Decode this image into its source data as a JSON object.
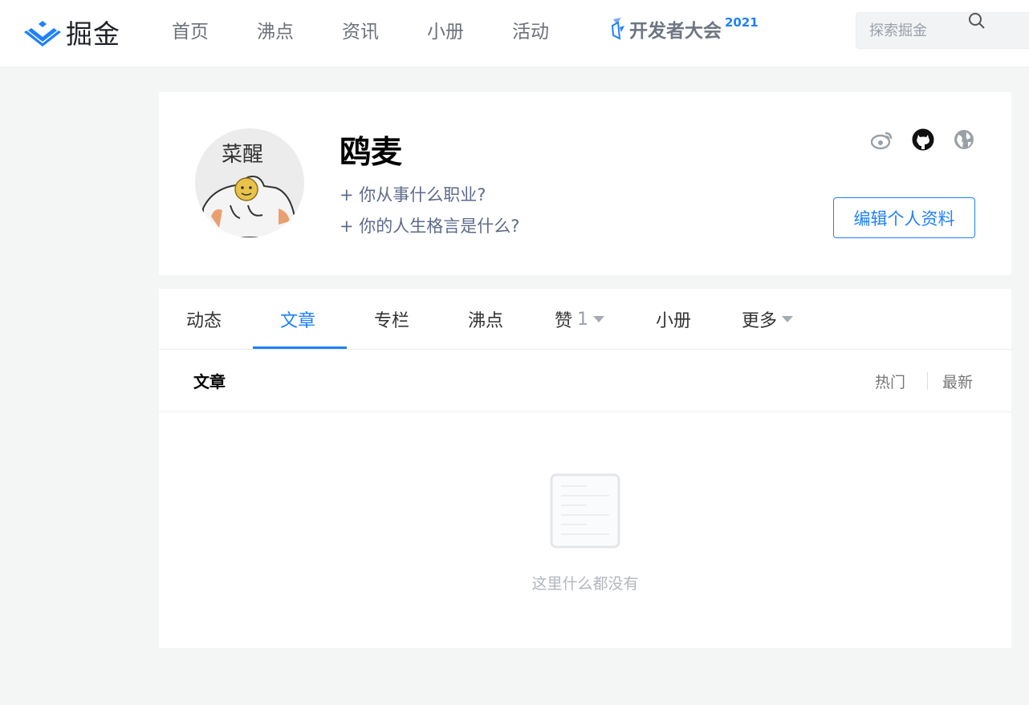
{
  "header": {
    "logo_text": "掘金",
    "nav": [
      "首页",
      "沸点",
      "资讯",
      "小册",
      "活动"
    ],
    "event_text": "开发者大会",
    "event_year": "2021",
    "search_placeholder": "探索掘金",
    "accent": "#1e80ff"
  },
  "profile": {
    "avatar_text": "菜醒",
    "name": "鸥麦",
    "add_job": "+ 你从事什么职业?",
    "add_motto": "+ 你的人生格言是什么?",
    "social_icons": [
      "weibo-icon",
      "github-icon",
      "globe-icon"
    ],
    "edit_label": "编辑个人资料"
  },
  "tabs": {
    "items": [
      "动态",
      "文章",
      "专栏",
      "沸点",
      "赞",
      "小册",
      "更多"
    ],
    "active": "文章",
    "like_count": "1"
  },
  "subbar": {
    "title": "文章",
    "sort_hot": "热门",
    "sort_new": "最新"
  },
  "empty": {
    "text": "这里什么都没有"
  }
}
